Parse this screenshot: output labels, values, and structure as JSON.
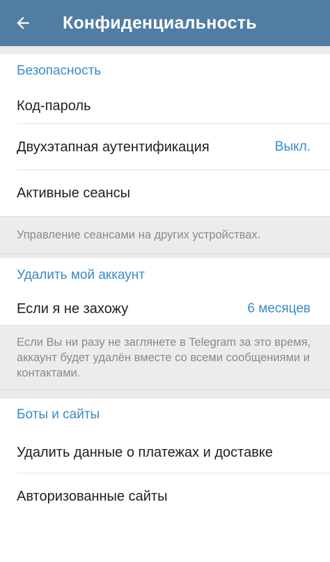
{
  "appbar": {
    "title": "Конфиденциальность",
    "back_icon": "arrow-left-icon",
    "background": "#517da2"
  },
  "sections": {
    "security": {
      "header": "Безопасность",
      "items": [
        {
          "label": "Код-пароль",
          "value": ""
        },
        {
          "label": "Двухэтапная аутентификация",
          "value": "Выкл."
        },
        {
          "label": "Активные сеансы",
          "value": ""
        }
      ],
      "info": "Управление сеансами на других устройствах."
    },
    "delete_account": {
      "header": "Удалить мой аккаунт",
      "items": [
        {
          "label": "Если я не захожу",
          "value": "6 месяцев"
        }
      ],
      "info": "Если Вы ни разу не заглянете в Telegram за это время, аккаунт будет удалён вместе со всеми сообщениями и контактами."
    },
    "bots": {
      "header": "Боты и сайты",
      "items": [
        {
          "label": "Удалить данные о платежах и доставке",
          "value": ""
        },
        {
          "label": "Авторизованные сайты",
          "value": ""
        }
      ]
    }
  },
  "colors": {
    "accent": "#3a8bc8",
    "info_background": "#ececec",
    "info_text": "#8a8a8a"
  }
}
